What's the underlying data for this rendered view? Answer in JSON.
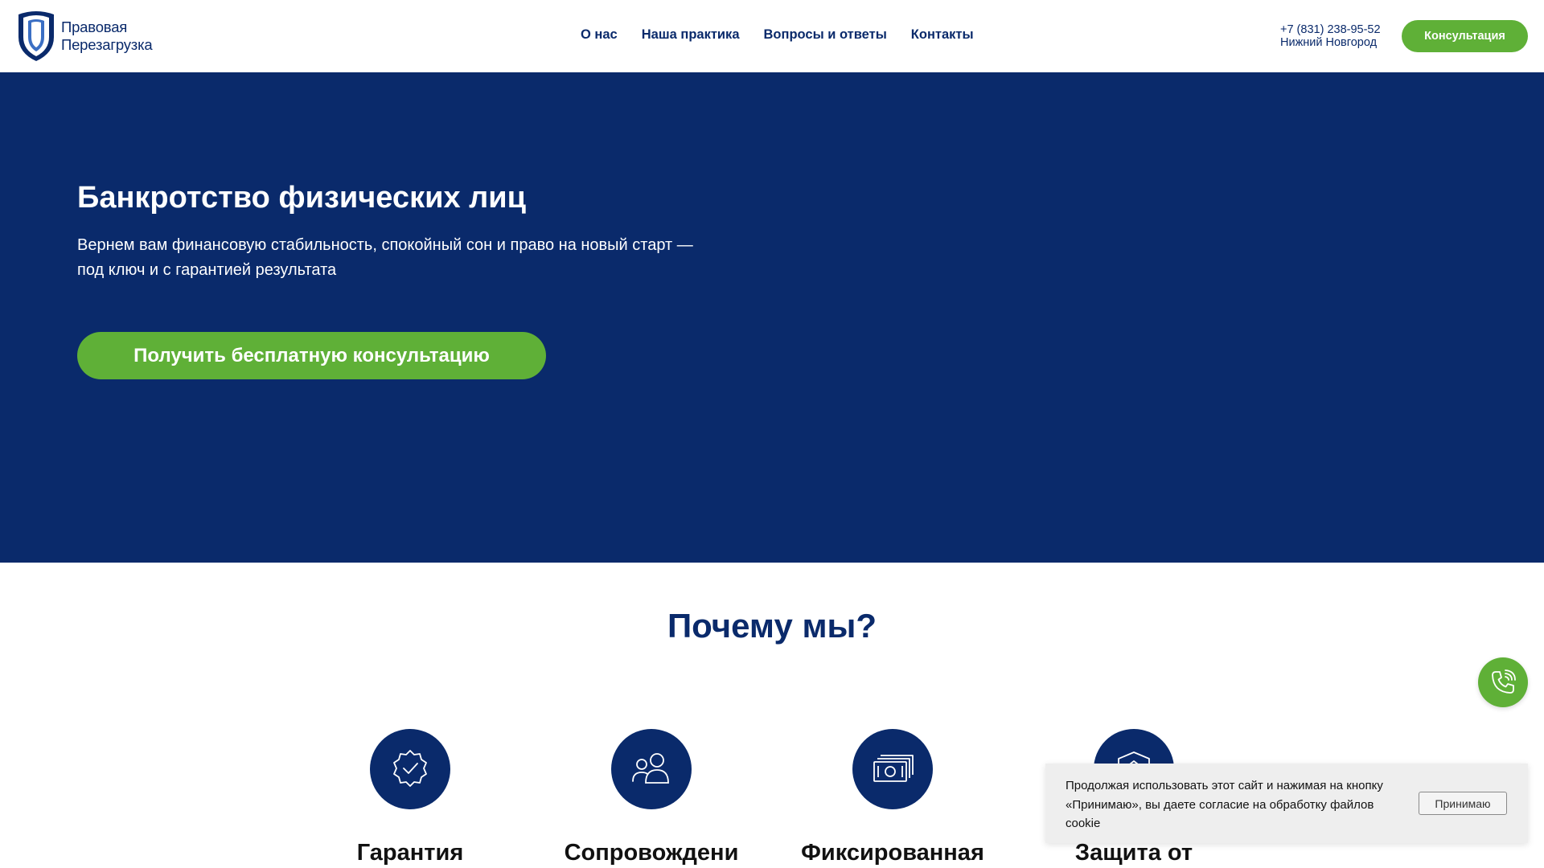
{
  "brand": {
    "name_line1": "Правовая",
    "name_line2": "Перезагрузка",
    "icon": "shield-logo-icon"
  },
  "nav": {
    "items": [
      {
        "label": "О нас"
      },
      {
        "label": "Наша практика"
      },
      {
        "label": "Вопросы и ответы"
      },
      {
        "label": "Контакты"
      }
    ]
  },
  "contact": {
    "phone": "+7 (831) 238-95-52",
    "city": "Нижний Новгород"
  },
  "header": {
    "cta_label": "Консультация"
  },
  "hero": {
    "title": "Банкротство физических лиц",
    "subtitle_line1": "Вернем вам финансовую стабильность, спокойный сон и право на новый старт —",
    "subtitle_line2": "под ключ и с гарантией результата",
    "cta_label": "Получить бесплатную консультацию"
  },
  "why_us": {
    "title": "Почему мы?",
    "features": [
      {
        "title": "Гарантия",
        "icon": "badge-check-icon"
      },
      {
        "title": "Сопровождени",
        "icon": "users-icon"
      },
      {
        "title": "Фиксированная",
        "icon": "money-icon"
      },
      {
        "title": "Защита от",
        "icon": "shield-icon"
      }
    ]
  },
  "floating": {
    "icon": "phone-icon"
  },
  "cookie": {
    "text_line1": "Продолжая использовать этот сайт и нажимая на кнопку",
    "text_line2": "«Принимаю», вы даете согласие на обработку файлов",
    "text_line3": "cookie",
    "accept_label": "Принимаю"
  },
  "colors": {
    "brand_navy": "#0a2a6b",
    "accent_green": "#5fb037",
    "cookie_bg": "#eeeeee"
  }
}
